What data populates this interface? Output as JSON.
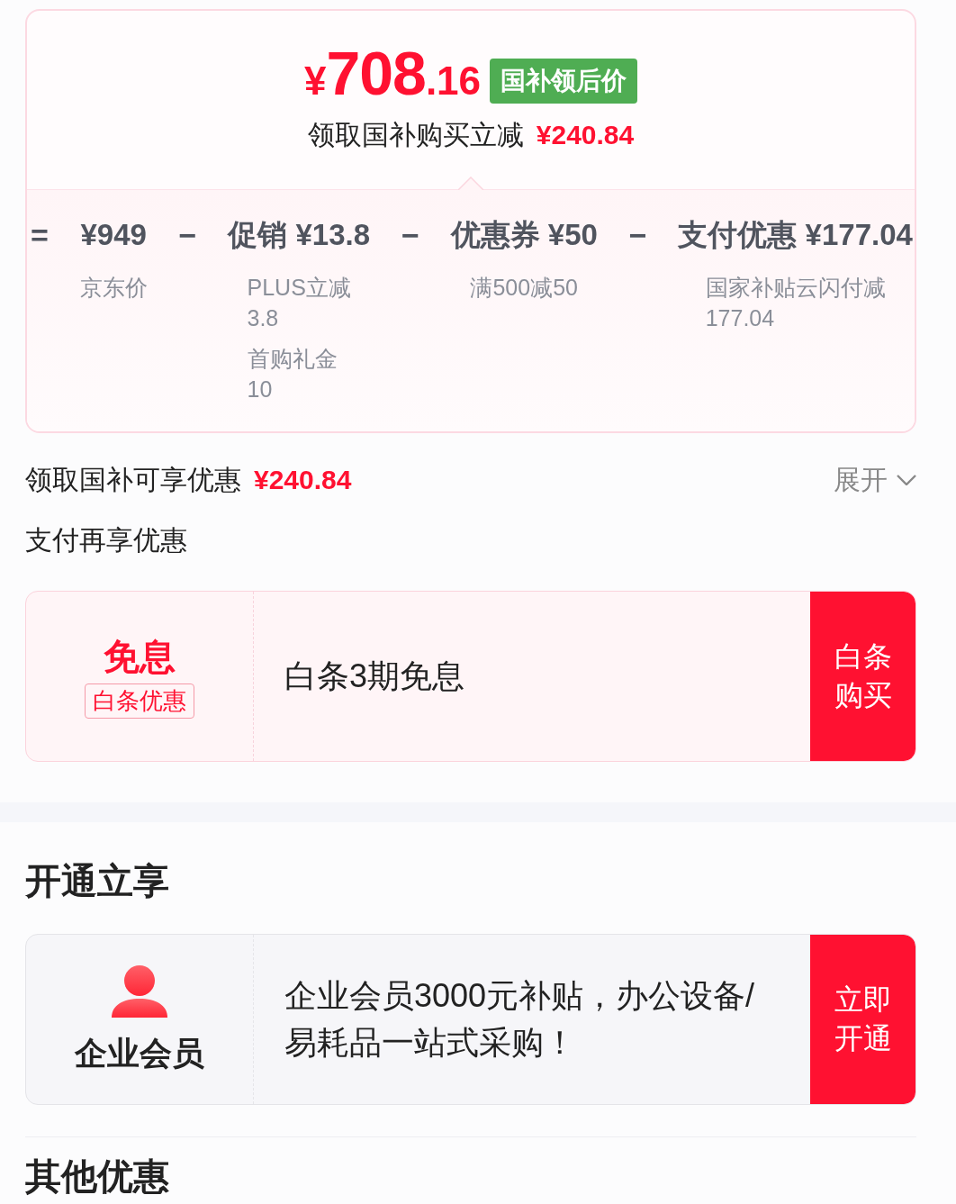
{
  "price_card": {
    "currency": "¥",
    "price_integer": "708",
    "price_decimal": ".16",
    "badge": "国补领后价",
    "subtitle": "领取国补购买立减",
    "subtitle_amount": "¥240.84",
    "breakdown": [
      {
        "operator": "=",
        "value": "¥949",
        "notes": [
          {
            "label": "京东价"
          }
        ]
      },
      {
        "operator": "−",
        "value": "促销 ¥13.8",
        "notes": [
          {
            "label": "PLUS立减",
            "amount": "3.8"
          },
          {
            "label": "首购礼金",
            "amount": "10"
          }
        ]
      },
      {
        "operator": "−",
        "value": "优惠券 ¥50",
        "notes": [
          {
            "label": "满500减50"
          }
        ]
      },
      {
        "operator": "−",
        "value": "支付优惠 ¥177.04",
        "notes": [
          {
            "label": "国家补贴云闪付减",
            "amount": "177.04"
          }
        ]
      }
    ]
  },
  "subsidy_row": {
    "label": "领取国补可享优惠",
    "amount": "¥240.84",
    "toggle": "展开",
    "expanded": false
  },
  "payment_section": {
    "title": "支付再享优惠",
    "offers": [
      {
        "kind": "tag",
        "headline": "免息",
        "tag": "白条优惠",
        "description": "白条3期免息",
        "action": "白条购买"
      }
    ]
  },
  "membership_section": {
    "title": "开通立享",
    "offers": [
      {
        "kind": "member",
        "headline": "企业会员",
        "description": "企业会员3000元补贴，办公设备/易耗品一站式采购！",
        "action": "立即开通"
      }
    ]
  },
  "other_section": {
    "title": "其他优惠"
  }
}
